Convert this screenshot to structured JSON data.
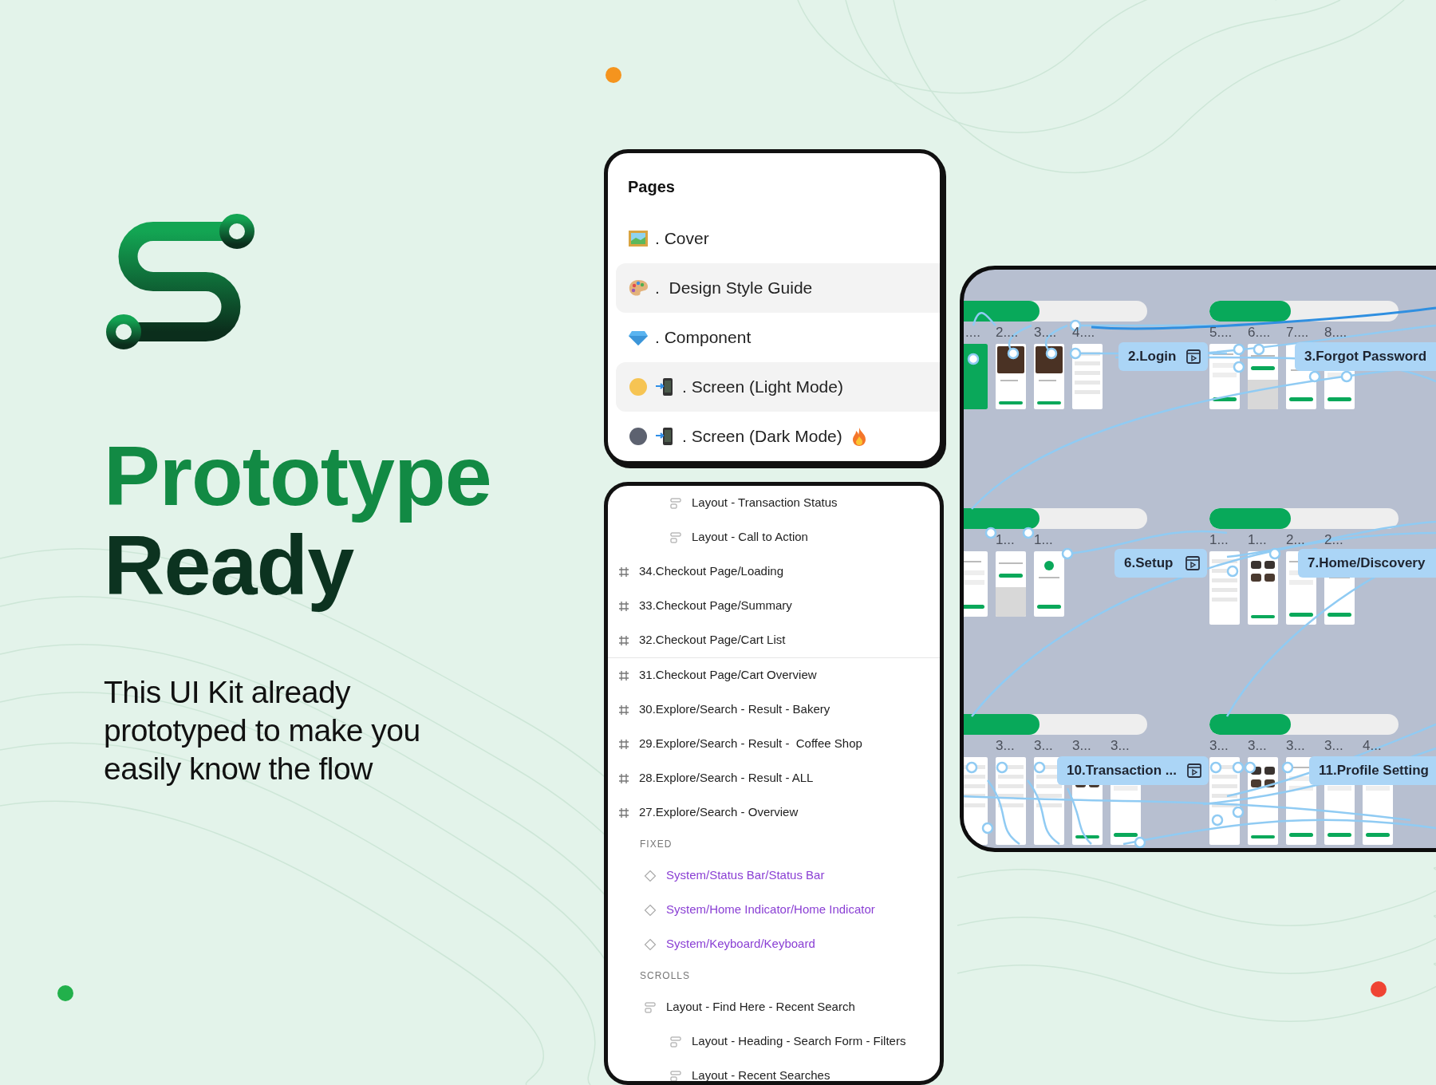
{
  "heading": {
    "lines": [
      "Prototype",
      "Ready"
    ]
  },
  "description": "This UI Kit already prototyped to make you easily know the flow",
  "decor_dots": [
    {
      "color": "#f5941e"
    },
    {
      "color": "#22b04b"
    },
    {
      "color": "#ef4433"
    }
  ],
  "pages_panel": {
    "title": "Pages",
    "items": [
      {
        "label": ". Cover",
        "highlighted": false,
        "flame": false
      },
      {
        "label": ".  Design Style Guide",
        "highlighted": true,
        "flame": false
      },
      {
        "label": ". Component",
        "highlighted": false,
        "flame": false
      },
      {
        "label": ". Screen (Light Mode)",
        "highlighted": true,
        "flame": false
      },
      {
        "label": ". Screen (Dark Mode)",
        "highlighted": false,
        "flame": true
      }
    ]
  },
  "layers": [
    {
      "kind": "continued",
      "children": [
        {
          "kind": "layout",
          "label": "Layout - Transaction Status"
        },
        {
          "kind": "layout",
          "label": "Layout - Call to Action"
        }
      ]
    },
    {
      "kind": "frame",
      "label": "34.Checkout Page/Loading",
      "divider_after": false
    },
    {
      "kind": "frame",
      "label": "33.Checkout Page/Summary",
      "divider_after": false
    },
    {
      "kind": "frame",
      "label": "32.Checkout Page/Cart List",
      "divider_after": true
    },
    {
      "kind": "frame",
      "label": "31.Checkout Page/Cart Overview",
      "divider_after": false
    },
    {
      "kind": "frame",
      "label": "30.Explore/Search - Result - Bakery",
      "divider_after": false
    },
    {
      "kind": "frame",
      "label": "29.Explore/Search - Result -  Coffee Shop",
      "divider_after": false
    },
    {
      "kind": "frame",
      "label": "28.Explore/Search - Result - ALL",
      "divider_after": false
    },
    {
      "kind": "frame",
      "label": "27.Explore/Search - Overview",
      "divider_after": false
    },
    {
      "kind": "section",
      "label": "FIXED",
      "children": [
        {
          "kind": "component",
          "label": "System/Status Bar/Status Bar"
        },
        {
          "kind": "component",
          "label": "System/Home Indicator/Home Indicator"
        },
        {
          "kind": "component",
          "label": "System/Keyboard/Keyboard"
        }
      ]
    },
    {
      "kind": "section",
      "label": "SCROLLS",
      "children": [
        {
          "kind": "layout",
          "label": "Layout - Find Here - Recent Search",
          "children": [
            {
              "kind": "layout",
              "label": "Layout - Heading - Search Form - Filters"
            },
            {
              "kind": "layout",
              "label": "Layout - Recent Searches"
            }
          ]
        }
      ]
    }
  ],
  "canvas": {
    "groups": [
      {
        "frames": [
          {
            "number": "....",
            "kind": "splash"
          },
          {
            "number": "2....",
            "kind": "photo"
          },
          {
            "number": "3....",
            "kind": "photo"
          },
          {
            "number": "4....",
            "kind": "list"
          }
        ]
      },
      {
        "frames": [
          {
            "number": "5....",
            "kind": "form"
          },
          {
            "number": "6....",
            "kind": "keypad"
          },
          {
            "number": "7....",
            "kind": "success"
          },
          {
            "number": "8....",
            "kind": "form"
          }
        ]
      },
      {
        "frames": [
          {
            "kind": "form"
          },
          {
            "number": "1...",
            "kind": "keypad"
          },
          {
            "number": "1...",
            "kind": "success"
          }
        ]
      },
      {
        "frames": [
          {
            "number": "1...",
            "kind": "list"
          },
          {
            "number": "1...",
            "kind": "grid"
          },
          {
            "number": "2...",
            "kind": "form"
          },
          {
            "number": "2...",
            "kind": "success"
          }
        ]
      },
      {
        "frames": [
          {
            "kind": "list"
          },
          {
            "number": "3...",
            "kind": "list"
          },
          {
            "number": "3...",
            "kind": "list"
          },
          {
            "number": "3...",
            "kind": "grid"
          },
          {
            "number": "3...",
            "kind": "form"
          }
        ]
      },
      {
        "frames": [
          {
            "number": "3...",
            "kind": "list"
          },
          {
            "number": "3...",
            "kind": "grid"
          },
          {
            "number": "3...",
            "kind": "form"
          },
          {
            "number": "3...",
            "kind": "form"
          },
          {
            "number": "4...",
            "kind": "form"
          }
        ]
      }
    ],
    "flows": [
      {
        "label": "2.Login",
        "play_icon": true
      },
      {
        "label": "3.Forgot Password",
        "play_icon": false
      },
      {
        "label": "6.Setup",
        "play_icon": true
      },
      {
        "label": "7.Home/Discovery",
        "play_icon": false
      },
      {
        "label": "10.Transaction ...",
        "play_icon": true
      },
      {
        "label": "11.Profile Setting",
        "play_icon": false
      }
    ]
  }
}
